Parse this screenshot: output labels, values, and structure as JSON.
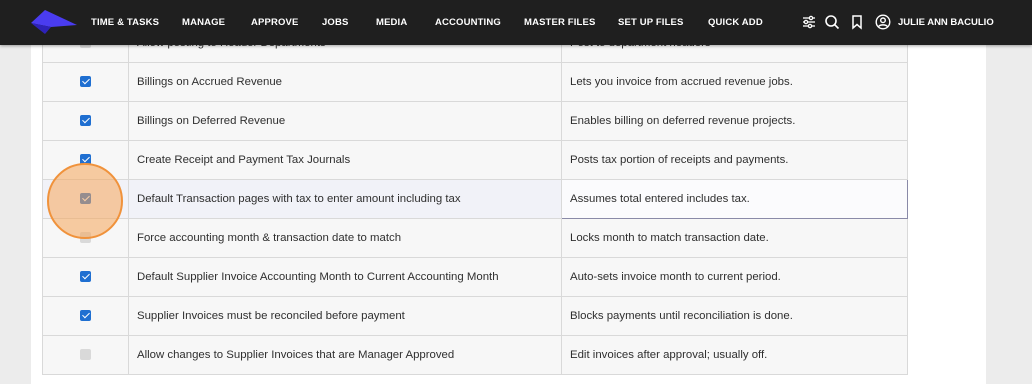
{
  "nav": {
    "items": [
      "TIME & TASKS",
      "MANAGE",
      "APPROVE",
      "JOBS",
      "MEDIA",
      "ACCOUNTING",
      "MASTER FILES",
      "SET UP FILES",
      "QUICK ADD"
    ],
    "user_name": "JULIE ANN BACULIO",
    "icons": [
      "sliders-icon",
      "search-icon",
      "bookmark-icon",
      "user-circle-icon"
    ],
    "logo_color": "#4a3cf0"
  },
  "settings": {
    "rows": [
      {
        "name": "Allow posting to Header Departments",
        "description": "Post to department headers",
        "checked": false
      },
      {
        "name": "Billings on Accrued Revenue",
        "description": "Lets you invoice from accrued revenue jobs.",
        "checked": true
      },
      {
        "name": "Billings on Deferred Revenue",
        "description": "Enables billing on deferred revenue projects.",
        "checked": true
      },
      {
        "name": "Create Receipt and Payment Tax Journals",
        "description": "Posts tax portion of receipts and payments.",
        "checked": true
      },
      {
        "name": "Default Transaction pages with tax to enter amount including tax",
        "description": "Assumes total entered includes tax.",
        "checked": true
      },
      {
        "name": "Force accounting month & transaction date to match",
        "description": "Locks month to match transaction date.",
        "checked": false
      },
      {
        "name": "Default Supplier Invoice Accounting Month to Current Accounting Month",
        "description": "Auto-sets invoice month to current period.",
        "checked": true
      },
      {
        "name": "Supplier Invoices must be reconciled before payment",
        "description": "Blocks payments until reconciliation is done.",
        "checked": true
      },
      {
        "name": "Allow changes to Supplier Invoices that are Manager Approved",
        "description": "Edit invoices after approval; usually off.",
        "checked": false
      }
    ]
  },
  "colors": {
    "checkbox_on": "#1f6fd1",
    "checkbox_off": "#d9d9d9",
    "click_marker": "#f0923b"
  }
}
